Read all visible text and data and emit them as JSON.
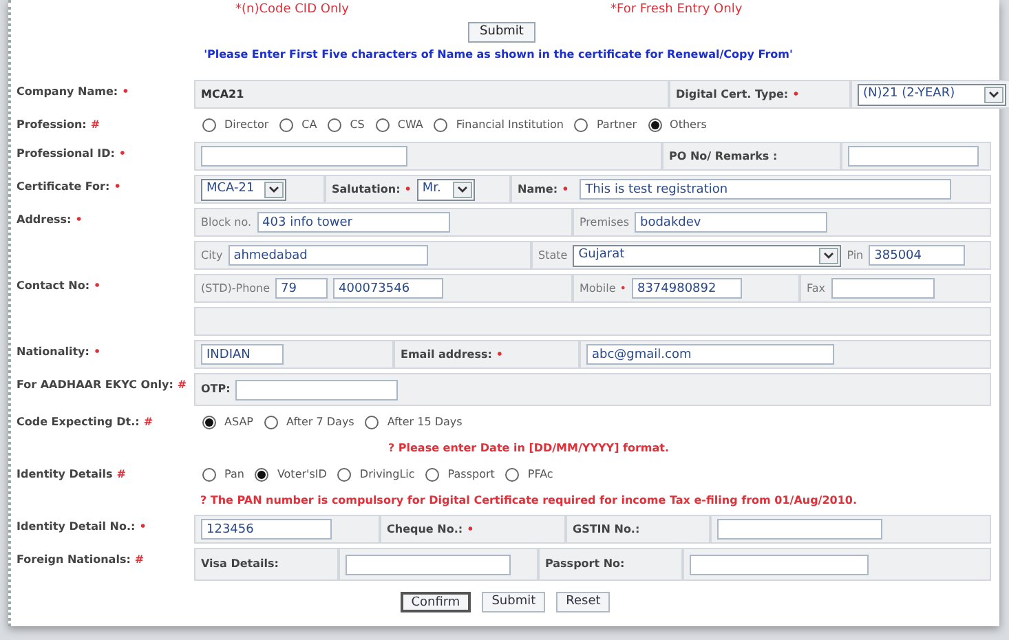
{
  "header": {
    "notes": [
      "*(n)Code CID Only",
      "*For Fresh Entry Only"
    ],
    "submit": "Submit",
    "instruction": "'Please Enter First Five characters of Name as shown in the certificate for Renewal/Copy From'"
  },
  "rows": [
    {
      "kind": "field",
      "label": "Company Name:",
      "marker": "•",
      "groups": [
        [
          {
            "kind": "value",
            "text": "MCA21"
          }
        ],
        [
          {
            "kind": "text",
            "text": "Digital Cert. Type:",
            "marker": "•"
          }
        ],
        [
          {
            "kind": "select",
            "value": "(N)21 (2-YEAR)"
          }
        ]
      ]
    },
    {
      "kind": "radios",
      "label": "Profession:",
      "marker": "#",
      "options": [
        {
          "label": "Director",
          "selected": false
        },
        {
          "label": "CA",
          "selected": false
        },
        {
          "label": "CS",
          "selected": false
        },
        {
          "label": "CWA",
          "selected": false
        },
        {
          "label": "Financial Institution",
          "selected": false
        },
        {
          "label": "Partner",
          "selected": false
        },
        {
          "label": "Others",
          "selected": true
        }
      ]
    },
    {
      "kind": "field",
      "label": "Professional ID:",
      "marker": "•",
      "groups": [
        [
          {
            "kind": "input"
          }
        ],
        [
          {
            "kind": "text",
            "text": "PO No/ Remarks :"
          }
        ],
        [
          {
            "kind": "input"
          }
        ]
      ]
    },
    {
      "kind": "field",
      "label": "Certificate For:",
      "marker": "•",
      "groups": [
        [
          {
            "kind": "select",
            "value": "MCA-21"
          }
        ],
        [
          {
            "kind": "text",
            "text": "Salutation:",
            "marker": "•"
          },
          {
            "kind": "select",
            "value": "Mr."
          }
        ],
        [
          {
            "kind": "text",
            "text": "Name:",
            "marker": "•"
          },
          {
            "kind": "input",
            "value": "This is test registration"
          }
        ]
      ]
    },
    {
      "kind": "field",
      "label": "Address:",
      "marker": "•",
      "groups": [
        [
          {
            "kind": "hint",
            "text": "Block no."
          },
          {
            "kind": "input",
            "value": "403 info tower"
          }
        ],
        [
          {
            "kind": "hint",
            "text": "Premises"
          },
          {
            "kind": "input",
            "value": "bodakdev"
          }
        ]
      ]
    },
    {
      "kind": "field",
      "groups": [
        [
          {
            "kind": "hint",
            "text": "City"
          },
          {
            "kind": "input",
            "value": "ahmedabad"
          }
        ],
        [
          {
            "kind": "hint",
            "text": "State"
          },
          {
            "kind": "select",
            "value": "Gujarat"
          },
          {
            "kind": "hint",
            "text": "Pin"
          },
          {
            "kind": "input",
            "value": "385004"
          }
        ]
      ]
    },
    {
      "kind": "field",
      "label": "Contact No:",
      "marker": "•",
      "groups": [
        [
          {
            "kind": "hint",
            "text": "(STD)-Phone"
          },
          {
            "kind": "input",
            "value": "79"
          },
          {
            "kind": "input",
            "value": "400073546"
          }
        ],
        [
          {
            "kind": "hint",
            "text": "Mobile",
            "marker": "•"
          },
          {
            "kind": "input",
            "value": "8374980892"
          }
        ],
        [
          {
            "kind": "hint",
            "text": "Fax"
          },
          {
            "kind": "input"
          }
        ]
      ]
    },
    {
      "kind": "blank"
    },
    {
      "kind": "field",
      "label": "Nationality:",
      "marker": "•",
      "groups": [
        [
          {
            "kind": "input",
            "value": "INDIAN"
          }
        ],
        [
          {
            "kind": "text",
            "text": "Email address:",
            "marker": "•"
          }
        ],
        [
          {
            "kind": "input",
            "value": "abc@gmail.com"
          }
        ]
      ]
    },
    {
      "kind": "field",
      "label": "For AADHAAR EKYC Only:",
      "marker": "#",
      "groups": [
        [
          {
            "kind": "text",
            "text": "OTP:"
          },
          {
            "kind": "input"
          }
        ]
      ]
    },
    {
      "kind": "radios",
      "label": "Code Expecting Dt.:",
      "marker": "#",
      "options": [
        {
          "label": "ASAP",
          "selected": true
        },
        {
          "label": "After 7 Days",
          "selected": false
        },
        {
          "label": "After 15 Days",
          "selected": false
        }
      ]
    },
    {
      "kind": "note",
      "text": "? Please enter Date in [DD/MM/YYYY] format."
    },
    {
      "kind": "radios",
      "label": "Identity Details",
      "marker": "#",
      "options": [
        {
          "label": "Pan",
          "selected": false
        },
        {
          "label": "Voter'sID",
          "selected": true
        },
        {
          "label": "DrivingLic",
          "selected": false
        },
        {
          "label": "Passport",
          "selected": false
        },
        {
          "label": "PFAc",
          "selected": false
        }
      ]
    },
    {
      "kind": "note",
      "text": "? The PAN number is compulsory for Digital Certificate required for income Tax e-filing from 01/Aug/2010."
    },
    {
      "kind": "field",
      "label": "Identity Detail No.:",
      "marker": "•",
      "groups": [
        [
          {
            "kind": "input",
            "value": "123456"
          }
        ],
        [
          {
            "kind": "text",
            "text": "Cheque No.:",
            "marker": "•"
          }
        ],
        [
          {
            "kind": "text",
            "text": "GSTIN No.:"
          }
        ],
        [
          {
            "kind": "input"
          }
        ]
      ]
    },
    {
      "kind": "field",
      "label": "Foreign Nationals:",
      "marker": "#",
      "groups": [
        [
          {
            "kind": "text",
            "text": "Visa Details:"
          }
        ],
        [
          {
            "kind": "input"
          }
        ],
        [
          {
            "kind": "text",
            "text": "Passport No:"
          }
        ],
        [
          {
            "kind": "input"
          }
        ]
      ]
    }
  ],
  "buttons": [
    {
      "label": "Confirm",
      "focused": true
    },
    {
      "label": "Submit",
      "focused": false
    },
    {
      "label": "Reset",
      "focused": false
    }
  ]
}
